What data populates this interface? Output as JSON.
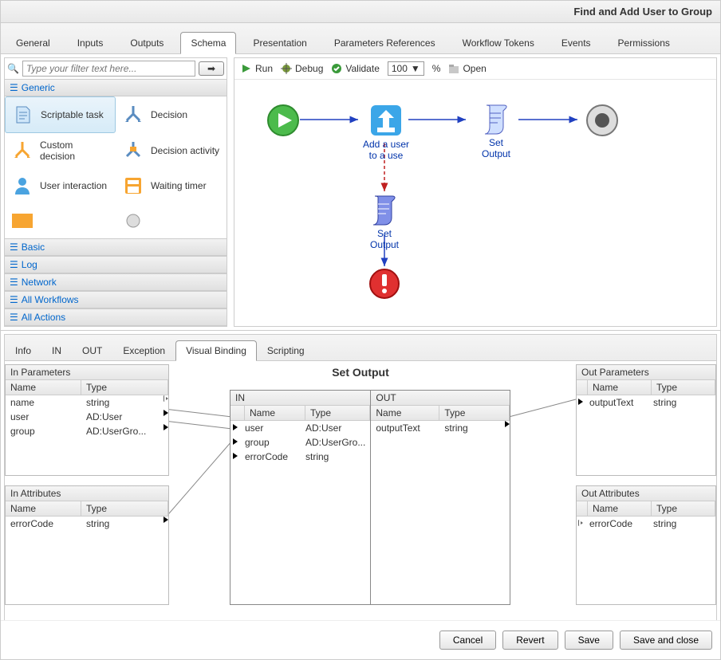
{
  "title": "Find and Add User to Group",
  "tabs": [
    "General",
    "Inputs",
    "Outputs",
    "Schema",
    "Presentation",
    "Parameters References",
    "Workflow Tokens",
    "Events",
    "Permissions"
  ],
  "activeTab": 3,
  "filter": {
    "placeholder": "Type your filter text here..."
  },
  "paletteCategories": {
    "generic": "Generic",
    "items": [
      {
        "label": "Scriptable task"
      },
      {
        "label": "Decision"
      },
      {
        "label": "Custom decision"
      },
      {
        "label": "Decision activity"
      },
      {
        "label": "User interaction"
      },
      {
        "label": "Waiting timer"
      }
    ],
    "others": [
      "Basic",
      "Log",
      "Network",
      "All Workflows",
      "All Actions"
    ]
  },
  "toolbar": {
    "run": "Run",
    "debug": "Debug",
    "validate": "Validate",
    "zoom": "100",
    "percent": "%",
    "open": "Open"
  },
  "canvasNodes": {
    "addUser": "Add a user to a use",
    "setOutput1": "Set Output",
    "setOutput2": "Set Output"
  },
  "subtabs": [
    "Info",
    "IN",
    "OUT",
    "Exception",
    "Visual Binding",
    "Scripting"
  ],
  "activeSubtab": 4,
  "binding": {
    "centerTitle": "Set Output",
    "inParams": {
      "title": "In Parameters",
      "cols": [
        "Name",
        "Type"
      ],
      "rows": [
        [
          "name",
          "string"
        ],
        [
          "user",
          "AD:User"
        ],
        [
          "group",
          "AD:UserGro..."
        ]
      ]
    },
    "inAttrs": {
      "title": "In Attributes",
      "cols": [
        "Name",
        "Type"
      ],
      "rows": [
        [
          "errorCode",
          "string"
        ]
      ]
    },
    "outParams": {
      "title": "Out Parameters",
      "cols": [
        "Name",
        "Type"
      ],
      "rows": [
        [
          "outputText",
          "string"
        ]
      ]
    },
    "outAttrs": {
      "title": "Out Attributes",
      "cols": [
        "Name",
        "Type"
      ],
      "rows": [
        [
          "errorCode",
          "string"
        ]
      ]
    },
    "inBox": {
      "title": "IN",
      "cols": [
        "Name",
        "Type"
      ],
      "rows": [
        [
          "user",
          "AD:User"
        ],
        [
          "group",
          "AD:UserGro..."
        ],
        [
          "errorCode",
          "string"
        ]
      ]
    },
    "outBox": {
      "title": "OUT",
      "cols": [
        "Name",
        "Type"
      ],
      "rows": [
        [
          "outputText",
          "string"
        ]
      ]
    }
  },
  "footer": {
    "cancel": "Cancel",
    "revert": "Revert",
    "save": "Save",
    "saveclose": "Save and close"
  }
}
